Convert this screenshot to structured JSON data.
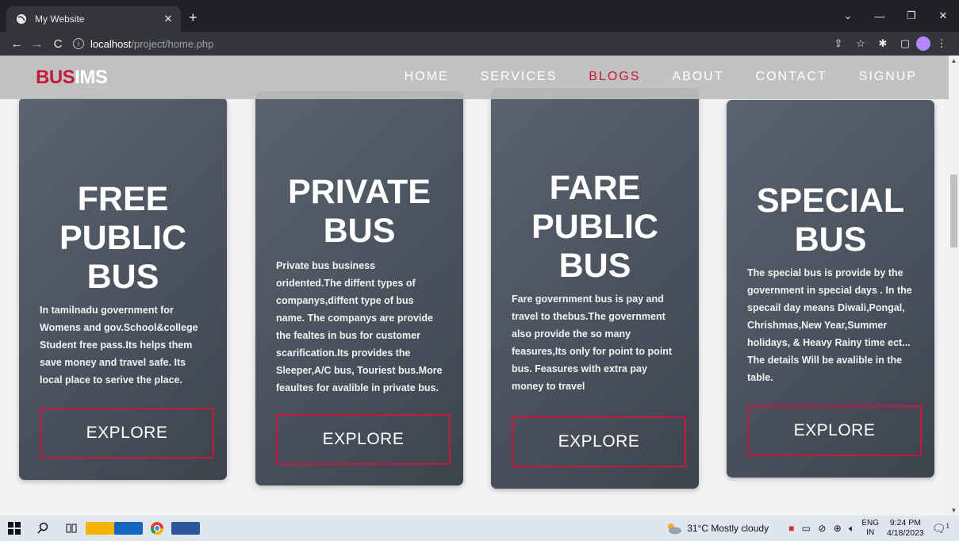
{
  "browser": {
    "tab_title": "My Website",
    "tab_close": "✕",
    "new_tab": "+",
    "url_host": "localhost",
    "url_path": "/project/home.php",
    "window_controls": [
      "⌄",
      "—",
      "❐",
      "✕"
    ],
    "toolbar_icons": [
      "⇪",
      "☆",
      "✱",
      "▢"
    ]
  },
  "site": {
    "logo_part1": "BUS",
    "logo_part2": "IMS",
    "nav": [
      "HOME",
      "SERVICES",
      "BLOGS",
      "ABOUT",
      "CONTACT",
      "SIGNUP"
    ],
    "active_nav": "BLOGS",
    "accent": "#c4183c"
  },
  "cards": [
    {
      "title": "FREE PUBLIC BUS",
      "text": "In tamilnadu government for Womens and gov.School&college Student free pass.Its helps them save money and travel safe. Its local place to serive the place.",
      "button": "EXPLORE"
    },
    {
      "title": "PRIVATE BUS",
      "text": "Private bus business oridented.The diffent types of companys,diffent type of bus name. The companys are provide the fealtes in bus for customer scarification.Its provides the Sleeper,A/C bus, Touriest bus.More feaultes for avalible in private bus.",
      "button": "EXPLORE"
    },
    {
      "title": "FARE PUBLIC BUS",
      "text": "Fare government bus is pay and travel to thebus.The government also provide the so many feasures,Its only for point to point bus. Feasures with extra pay money to travel",
      "button": "EXPLORE"
    },
    {
      "title": "SPECIAL BUS",
      "text": "The special bus is provide by the government in special days . In the specail day means Diwali,Pongal, Chrishmas,New Year,Summer holidays, & Heavy Rainy time ect... The details Will be avalible in the table.",
      "button": "EXPLORE"
    }
  ],
  "taskbar": {
    "weather": "31°C  Mostly cloudy",
    "lang_top": "ENG",
    "lang_bottom": "IN",
    "time": "9:24 PM",
    "date": "4/18/2023",
    "notification_count": "1"
  }
}
